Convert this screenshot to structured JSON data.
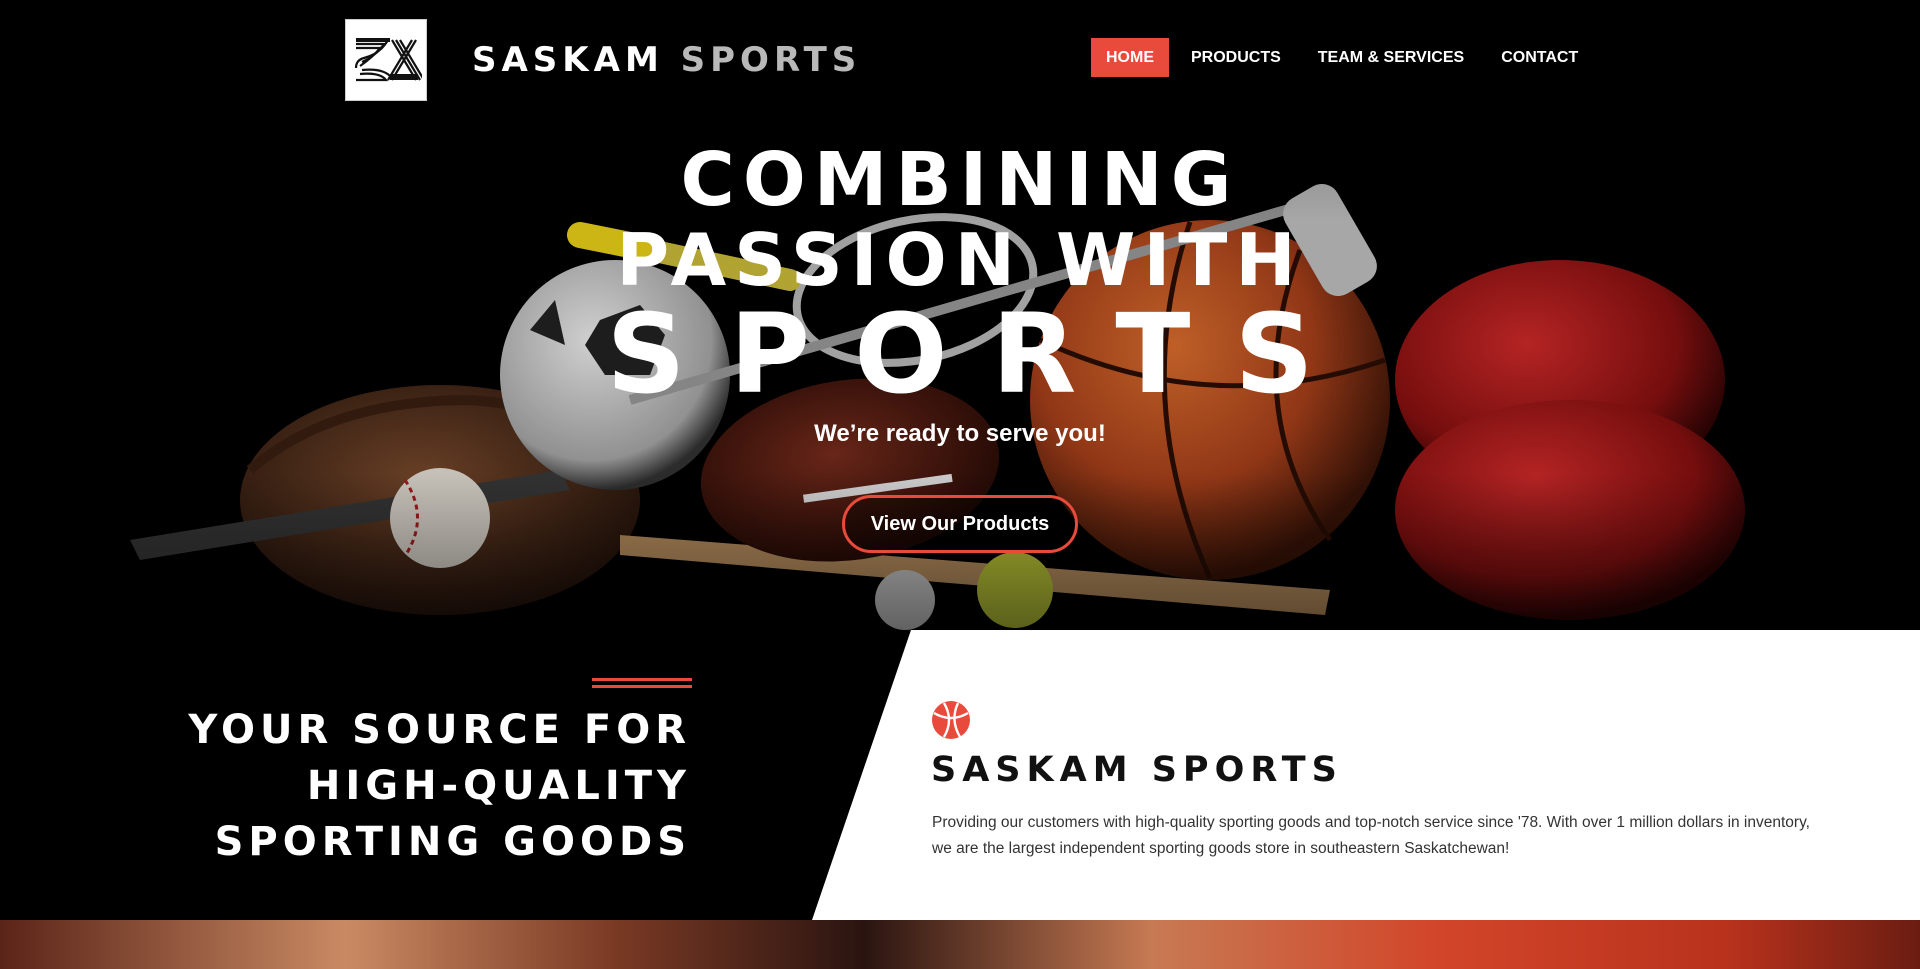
{
  "header": {
    "brand_primary": "SASKAM",
    "brand_secondary": "SPORTS",
    "logo_icon": "sk-logo-icon",
    "nav": [
      {
        "label": "HOME",
        "active": true
      },
      {
        "label": "PRODUCTS",
        "active": false
      },
      {
        "label": "TEAM & SERVICES",
        "active": false
      },
      {
        "label": "CONTACT",
        "active": false
      }
    ]
  },
  "hero": {
    "line1": "COMBINING",
    "line2": "PASSION WITH",
    "line3": "SPORTS",
    "tagline": "We’re ready to serve you!",
    "cta": "View Our Products",
    "background": "sports-equipment-photo"
  },
  "intro": {
    "source_lines": [
      "YOUR SOURCE FOR",
      "HIGH-QUALITY",
      "SPORTING GOODS"
    ],
    "icon": "basketball-icon",
    "title": "SASKAM SPORTS",
    "text": "Providing our customers with high-quality sporting goods and top-notch service since '78. With over 1 million dollars in inventory, we are the largest independent sporting goods store in southeastern Saskatchewan!"
  },
  "colors": {
    "accent": "#e84a3b",
    "dark": "#000000",
    "light": "#ffffff"
  }
}
